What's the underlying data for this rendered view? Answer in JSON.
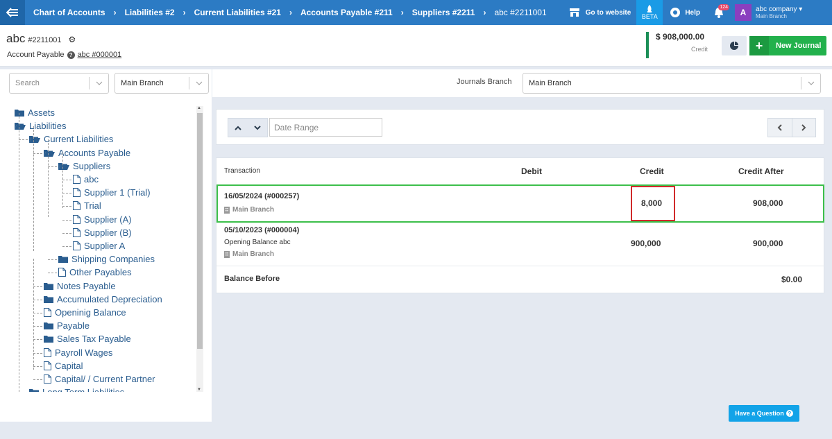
{
  "topbar": {
    "breadcrumbs": [
      "Chart of Accounts",
      "Liabilities #2",
      "Current Liabilities #21",
      "Accounts Payable #211",
      "Suppliers #2211"
    ],
    "current": "abc #2211001",
    "goto_website": "Go to website",
    "beta": "BETA",
    "help": "Help",
    "notifications": "124",
    "avatar_letter": "A",
    "company": "abc company",
    "company_branch": "Main Branch",
    "color": "#2c7bc4"
  },
  "header": {
    "account_name": "abc",
    "account_code": "#2211001",
    "account_type": "Account Payable",
    "parent_link": "abc #000001",
    "balance": "$ 908,000.00",
    "balance_type": "Credit",
    "new_journal": "New Journal"
  },
  "left": {
    "search_placeholder": "Search",
    "branch_select": "Main Branch",
    "tree": [
      {
        "label": "Assets",
        "icon": "folder-icon"
      },
      {
        "label": "Liabilities",
        "icon": "folder-open-icon"
      },
      {
        "label": "Current Liabilities",
        "icon": "folder-open-icon"
      },
      {
        "label": "Accounts Payable",
        "icon": "folder-open-icon"
      },
      {
        "label": "Suppliers",
        "icon": "folder-open-icon"
      },
      {
        "label": "abc",
        "icon": "file-icon"
      },
      {
        "label": "Supplier 1 (Trial)",
        "icon": "file-icon"
      },
      {
        "label": "Trial",
        "icon": "file-icon"
      },
      {
        "label": "Supplier (A)",
        "icon": "file-icon"
      },
      {
        "label": "Supplier (B)",
        "icon": "file-icon"
      },
      {
        "label": "Supplier A",
        "icon": "file-icon"
      },
      {
        "label": "Shipping Companies",
        "icon": "folder-icon"
      },
      {
        "label": "Other Payables",
        "icon": "file-icon"
      },
      {
        "label": "Notes Payable",
        "icon": "folder-icon"
      },
      {
        "label": "Accumulated Depreciation",
        "icon": "folder-icon"
      },
      {
        "label": "Openinig Balance",
        "icon": "file-icon"
      },
      {
        "label": "Payable",
        "icon": "folder-icon"
      },
      {
        "label": "Sales Tax Payable",
        "icon": "folder-icon"
      },
      {
        "label": "Payroll Wages",
        "icon": "file-icon"
      },
      {
        "label": "Capital",
        "icon": "file-icon"
      },
      {
        "label": "Capital/ / Current Partner",
        "icon": "file-icon"
      },
      {
        "label": "Long Term Liabilities",
        "icon": "folder-icon"
      }
    ]
  },
  "journals": {
    "branch_label": "Journals Branch",
    "branch_value": "Main Branch",
    "date_range_placeholder": "Date Range"
  },
  "table": {
    "columns": [
      "Transaction",
      "Debit",
      "Credit",
      "Credit After"
    ],
    "rows": [
      {
        "title": "16/05/2024 (#000257)",
        "desc": "",
        "branch": "Main Branch",
        "debit": "",
        "credit": "8,000",
        "credit_after": "908,000"
      },
      {
        "title": "05/10/2023 (#000004)",
        "desc": "Opening Balance abc",
        "branch": "Main Branch",
        "debit": "",
        "credit": "900,000",
        "credit_after": "900,000"
      }
    ],
    "balance_before_label": "Balance Before",
    "balance_before_value": "$0.00"
  },
  "help_button": "Have a Question"
}
